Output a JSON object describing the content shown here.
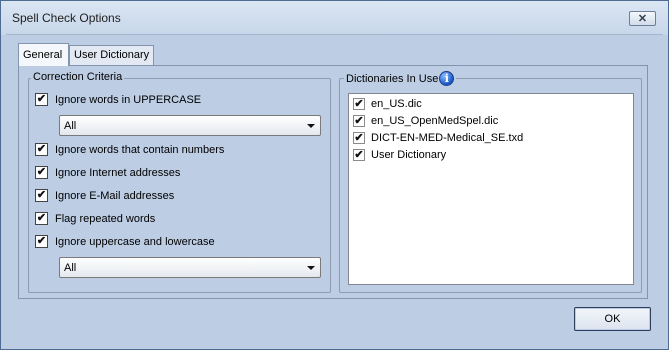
{
  "window": {
    "title": "Spell Check Options",
    "close_glyph": "✕"
  },
  "tabs": [
    {
      "label": "General",
      "active": true
    },
    {
      "label": "User Dictionary",
      "active": false
    }
  ],
  "correction_criteria": {
    "title": "Correction Criteria",
    "options": [
      {
        "label": "Ignore words in UPPERCASE",
        "checked": true
      },
      {
        "label": "Ignore words that contain numbers",
        "checked": true
      },
      {
        "label": "Ignore Internet addresses",
        "checked": true
      },
      {
        "label": "Ignore E-Mail addresses",
        "checked": true
      },
      {
        "label": "Flag repeated words",
        "checked": true
      },
      {
        "label": "Ignore uppercase and lowercase",
        "checked": true
      }
    ],
    "uppercase_combo": {
      "value": "All"
    },
    "case_combo": {
      "value": "All"
    }
  },
  "dictionaries": {
    "title": "Dictionaries In Use",
    "info_icon": "info-icon",
    "info_glyph": "i",
    "items": [
      {
        "label": "en_US.dic",
        "checked": true
      },
      {
        "label": "en_US_OpenMedSpel.dic",
        "checked": true
      },
      {
        "label": "DICT-EN-MED-Medical_SE.txd",
        "checked": true
      },
      {
        "label": "User Dictionary",
        "checked": true
      }
    ]
  },
  "buttons": {
    "ok_label": "OK"
  },
  "check_glyph": "✔",
  "colors": {
    "window_bg": "#bccde4",
    "accent_info": "#1a56c9"
  }
}
